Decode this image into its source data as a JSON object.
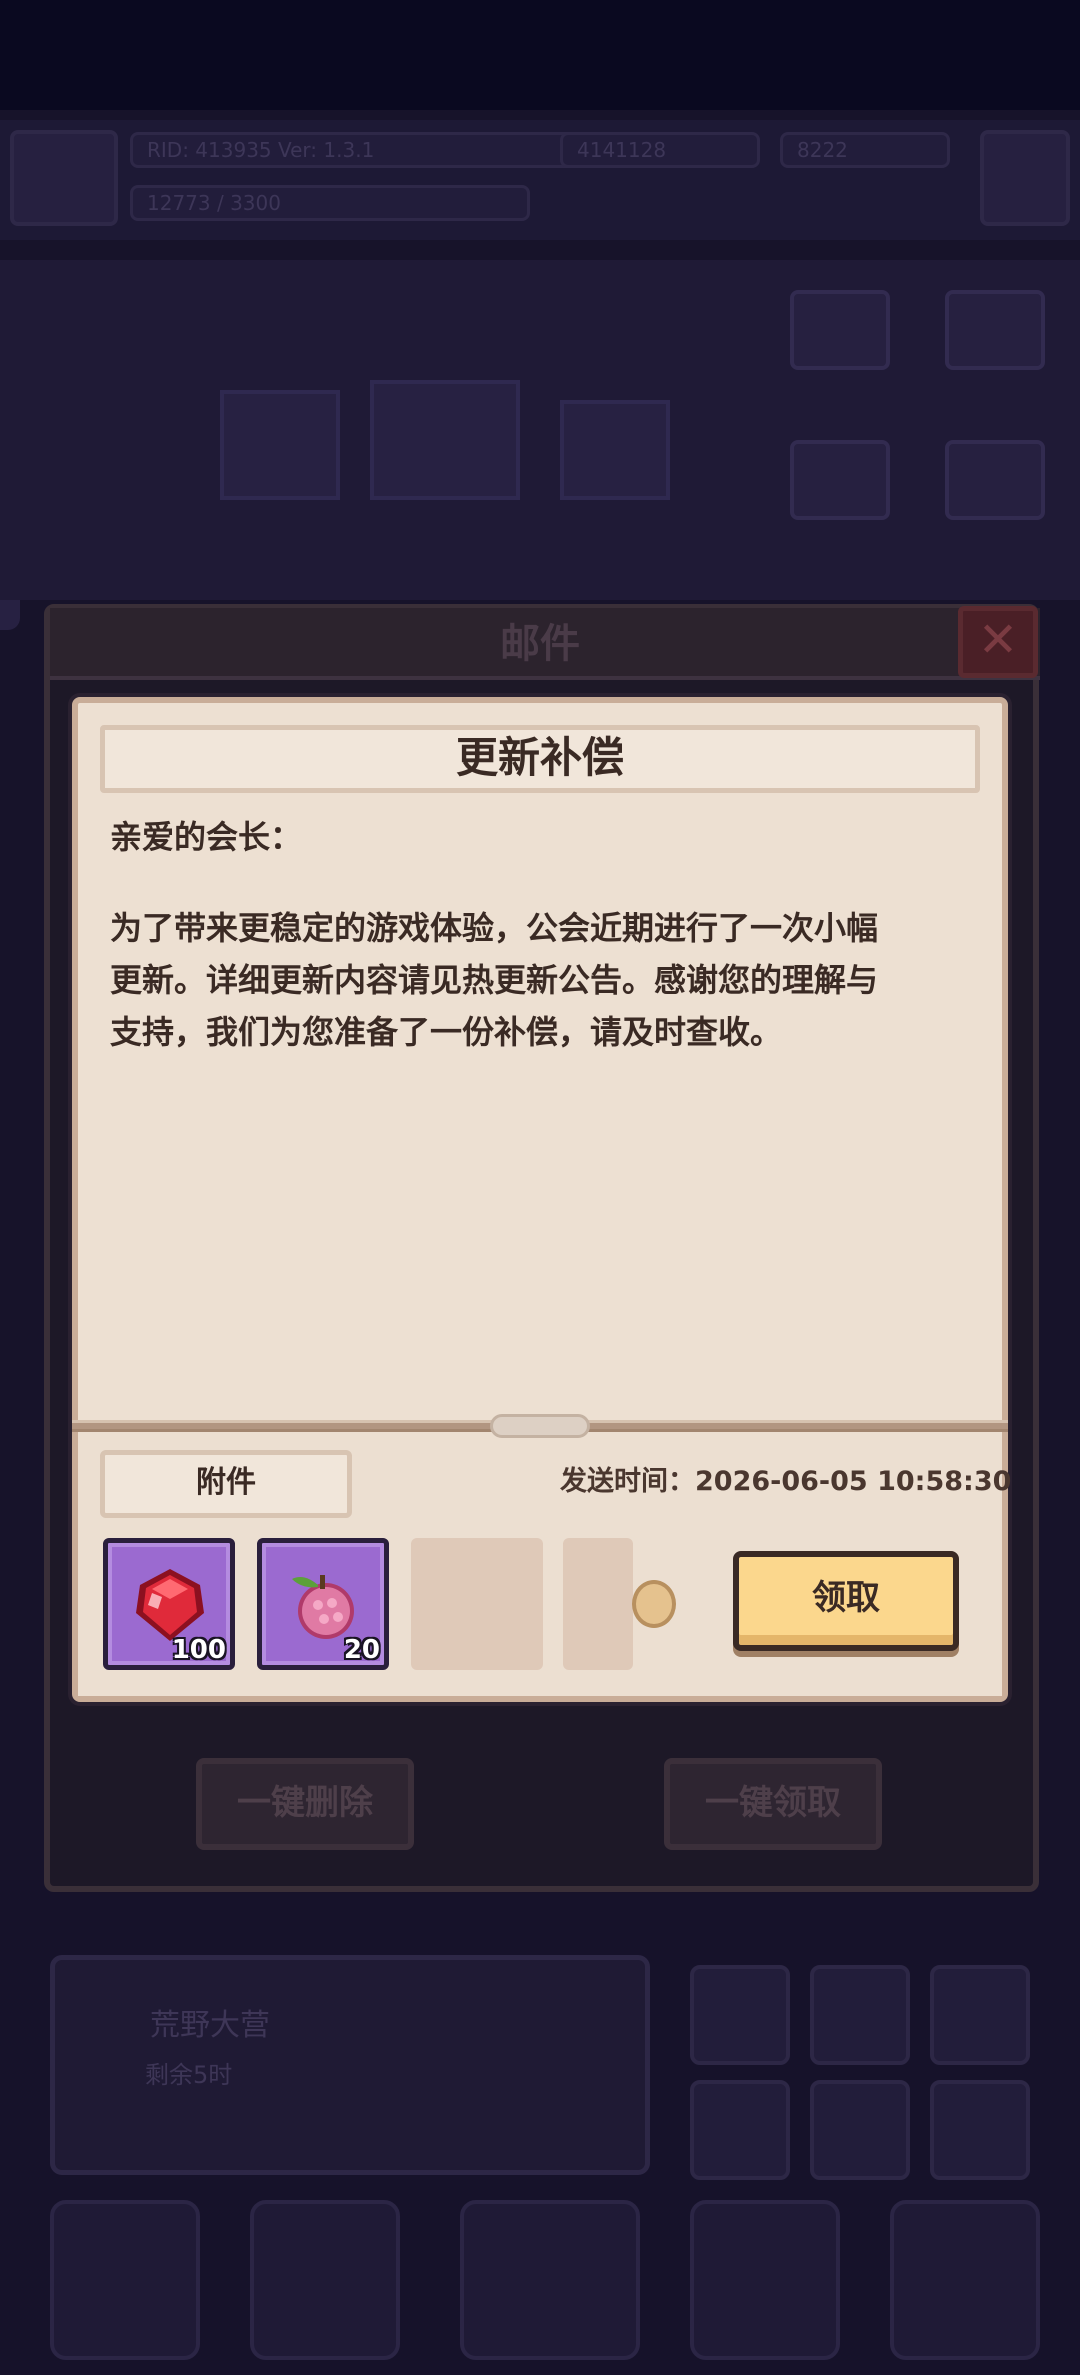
{
  "background": {
    "hud_left": "RID: 413935",
    "hud_mid": "Ver: 1.3.1",
    "hud_power": "4141128",
    "hud_gold": "8222",
    "hud_exp": "12773 / 3300",
    "panel_title": "荒野大营",
    "panel_sub": "剩余5时"
  },
  "mail": {
    "title": "邮件",
    "close_label": "✕",
    "subject": "更新补偿",
    "body_lines": [
      "亲爱的会长：",
      "为了带来更稳定的游戏体验，公会近期进行了一次小幅",
      "更新。详细更新内容请见热更新公告。感谢您的理解与",
      "支持，我们为您准备了一份补偿，请及时查收。"
    ],
    "attachment_label": "附件",
    "send_time": "发送时间：2026-06-05 10:58:30",
    "items": [
      {
        "icon": "red-gem-icon",
        "count": "100"
      },
      {
        "icon": "pink-fruit-icon",
        "count": "20"
      }
    ],
    "claim_label": "领取",
    "delete_all_label": "一键删除",
    "claim_all_label": "一键领取"
  },
  "colors": {
    "paper": "#ede0d2",
    "slot_purple": "#9b6ad0",
    "claim_button": "#fbd78d"
  }
}
